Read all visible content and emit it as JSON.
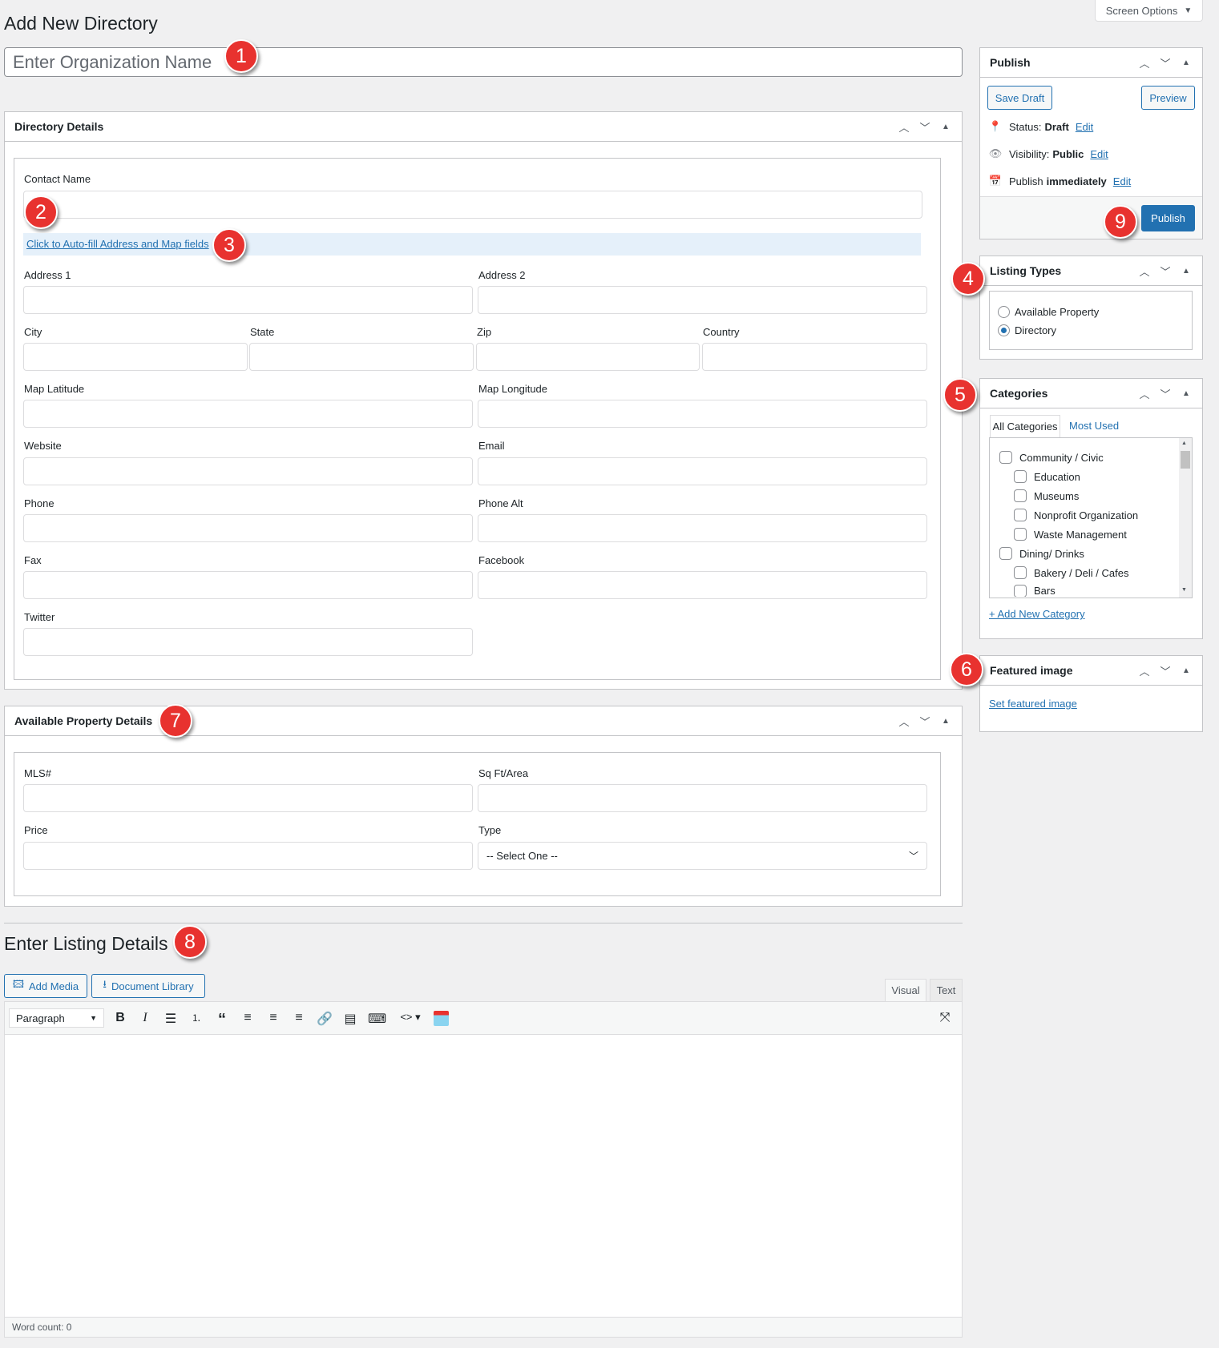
{
  "screen_options": {
    "label": "Screen Options",
    "arrow": "▼"
  },
  "page_title": "Add New Directory",
  "title_input": {
    "placeholder": "Enter Organization Name",
    "value": ""
  },
  "directory_details": {
    "title": "Directory Details",
    "autofill_link": "Click to Auto-fill Address and Map fields",
    "labels": {
      "contact_name": "Contact Name",
      "address1": "Address 1",
      "address2": "Address 2",
      "city": "City",
      "state": "State",
      "zip": "Zip",
      "country": "Country",
      "map_latitude": "Map Latitude",
      "map_longitude": "Map Longitude",
      "website": "Website",
      "email": "Email",
      "phone": "Phone",
      "phone_alt": "Phone Alt",
      "fax": "Fax",
      "facebook": "Facebook",
      "twitter": "Twitter"
    }
  },
  "property_details": {
    "title": "Available Property Details",
    "labels": {
      "mls": "MLS#",
      "sqft": "Sq Ft/Area",
      "price": "Price",
      "type": "Type"
    },
    "type_select_value": "-- Select One --"
  },
  "listing_details": {
    "title": "Enter Listing Details"
  },
  "editor": {
    "add_media": "Add Media",
    "document_library": "Document Library",
    "tab_visual": "Visual",
    "tab_text": "Text",
    "format_select": "Paragraph",
    "word_count": "Word count: 0"
  },
  "publish": {
    "title": "Publish",
    "save_draft": "Save Draft",
    "preview": "Preview",
    "status_label": "Status:",
    "status_value": "Draft",
    "visibility_label": "Visibility:",
    "visibility_value": "Public",
    "publish_label": "Publish",
    "publish_value": "immediately",
    "edit": "Edit",
    "publish_button": "Publish"
  },
  "listing_types": {
    "title": "Listing Types",
    "options": [
      {
        "label": "Available Property",
        "checked": false
      },
      {
        "label": "Directory",
        "checked": true
      }
    ]
  },
  "categories": {
    "title": "Categories",
    "tab_all": "All Categories",
    "tab_most_used": "Most Used",
    "items": [
      {
        "label": "Community / Civic",
        "level": 0
      },
      {
        "label": "Education",
        "level": 1
      },
      {
        "label": "Museums",
        "level": 1
      },
      {
        "label": "Nonprofit Organization",
        "level": 1
      },
      {
        "label": "Waste Management",
        "level": 1
      },
      {
        "label": "Dining/ Drinks",
        "level": 0
      },
      {
        "label": "Bakery / Deli / Cafes",
        "level": 1
      },
      {
        "label": "Bars",
        "level": 1
      }
    ],
    "add_new": "+ Add New Category"
  },
  "featured_image": {
    "title": "Featured image",
    "link": "Set featured image"
  },
  "badges": [
    "1",
    "2",
    "3",
    "4",
    "5",
    "6",
    "7",
    "8",
    "9"
  ],
  "colors": {
    "accent": "#2271b1",
    "badge": "#e8322f",
    "background": "#f0f0f1"
  }
}
